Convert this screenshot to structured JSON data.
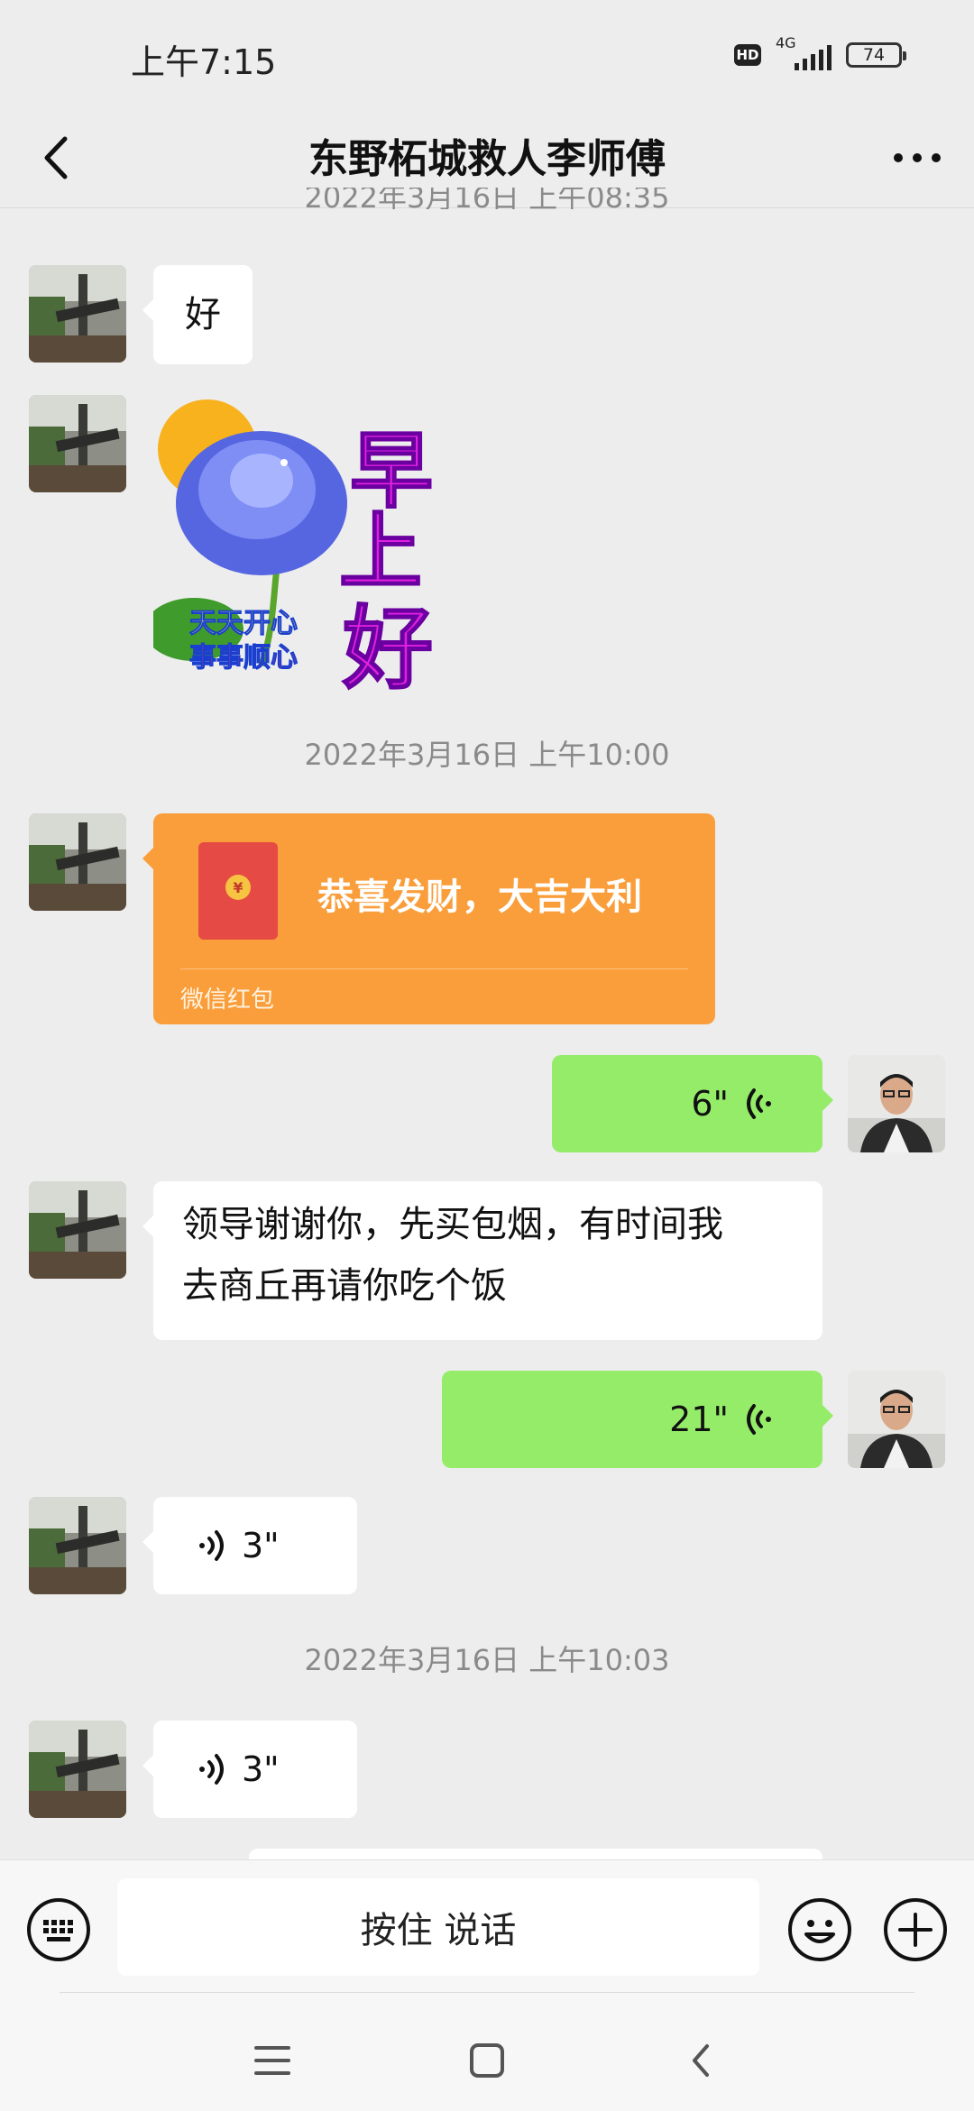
{
  "status_bar": {
    "time": "上午7:15",
    "hd": "HD",
    "network": "4G",
    "battery": "74"
  },
  "header": {
    "title": "东野柘城救人李师傅",
    "back_icon": "chevron-left-icon",
    "more_icon": "more-dots-icon"
  },
  "messages": {
    "partial_timestamp": "2022年3月16日 上午08:35",
    "msg1_text": "好",
    "sticker": {
      "big_chars": [
        "早",
        "上",
        "好"
      ],
      "line1": "天天开心",
      "line2": "事事顺心"
    },
    "timestamp2": "2022年3月16日 上午10:00",
    "red_packet": {
      "title": "恭喜发财，大吉大利",
      "label": "微信红包"
    },
    "voice_out1": "6\"",
    "msg_text_line1": "领导谢谢你，先买包烟，有时间我",
    "msg_text_line2": "去商丘再请你吃个饭",
    "voice_out2": "21\"",
    "voice_in1": "3\"",
    "timestamp3": "2022年3月16日 上午10:03",
    "voice_in2": "3\""
  },
  "input_bar": {
    "hold_to_talk": "按住 说话"
  },
  "colors": {
    "background": "#ededed",
    "out_bubble": "#95ec69",
    "red_packet": "#fa9e3b"
  }
}
